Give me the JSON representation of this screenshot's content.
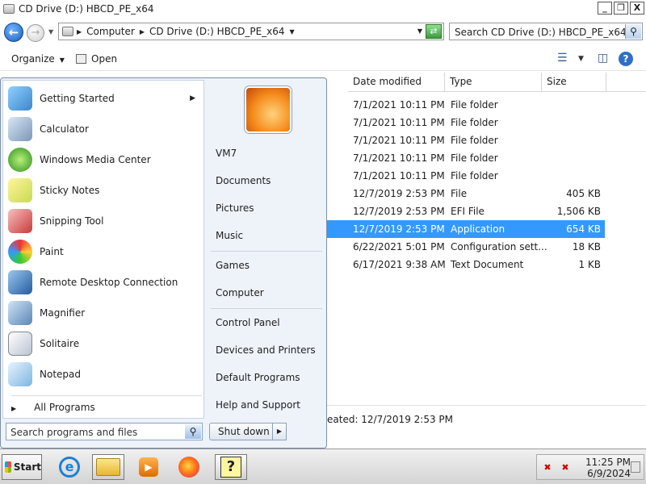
{
  "window": {
    "title": "CD Drive (D:) HBCD_PE_x64",
    "buttons": [
      "_",
      "❐",
      "X"
    ]
  },
  "address": {
    "crumbs": [
      "Computer",
      "CD Drive (D:) HBCD_PE_x64"
    ],
    "search_placeholder": "Search CD Drive (D:) HBCD_PE_x64"
  },
  "command_bar": {
    "organize": "Organize",
    "open": "Open"
  },
  "columns": {
    "date_modified": "Date modified",
    "type": "Type",
    "size": "Size"
  },
  "files": [
    {
      "date": "7/1/2021 10:11 PM",
      "type": "File folder",
      "size": ""
    },
    {
      "date": "7/1/2021 10:11 PM",
      "type": "File folder",
      "size": ""
    },
    {
      "date": "7/1/2021 10:11 PM",
      "type": "File folder",
      "size": ""
    },
    {
      "date": "7/1/2021 10:11 PM",
      "type": "File folder",
      "size": ""
    },
    {
      "date": "7/1/2021 10:11 PM",
      "type": "File folder",
      "size": ""
    },
    {
      "date": "12/7/2019 2:53 PM",
      "type": "File",
      "size": "405 KB"
    },
    {
      "date": "12/7/2019 2:53 PM",
      "type": "EFI File",
      "size": "1,506 KB"
    },
    {
      "date": "12/7/2019 2:53 PM",
      "type": "Application",
      "size": "654 KB"
    },
    {
      "date": "6/22/2021 5:01 PM",
      "type": "Configuration sett...",
      "size": "18 KB"
    },
    {
      "date": "6/17/2021 9:38 AM",
      "type": "Text Document",
      "size": "1 KB"
    }
  ],
  "details": {
    "created": "eated: 12/7/2019 2:53 PM"
  },
  "start_menu": {
    "programs": [
      {
        "label": "Getting Started",
        "icon": "getting-started-icon",
        "has_submenu": true
      },
      {
        "label": "Calculator",
        "icon": "calculator-icon"
      },
      {
        "label": "Windows Media Center",
        "icon": "media-center-icon"
      },
      {
        "label": "Sticky Notes",
        "icon": "sticky-notes-icon"
      },
      {
        "label": "Snipping Tool",
        "icon": "snipping-tool-icon"
      },
      {
        "label": "Paint",
        "icon": "paint-icon"
      },
      {
        "label": "Remote Desktop Connection",
        "icon": "remote-desktop-icon"
      },
      {
        "label": "Magnifier",
        "icon": "magnifier-icon"
      },
      {
        "label": "Solitaire",
        "icon": "solitaire-icon"
      },
      {
        "label": "Notepad",
        "icon": "notepad-icon"
      }
    ],
    "all_programs": "All Programs",
    "search_placeholder": "Search programs and files",
    "right_items": [
      "VM7",
      "Documents",
      "Pictures",
      "Music",
      "Games",
      "Computer",
      "Control Panel",
      "Devices and Printers",
      "Default Programs",
      "Help and Support"
    ],
    "shutdown": "Shut down"
  },
  "taskbar": {
    "start": "Start",
    "time": "11:25 PM",
    "date": "6/9/2024"
  }
}
